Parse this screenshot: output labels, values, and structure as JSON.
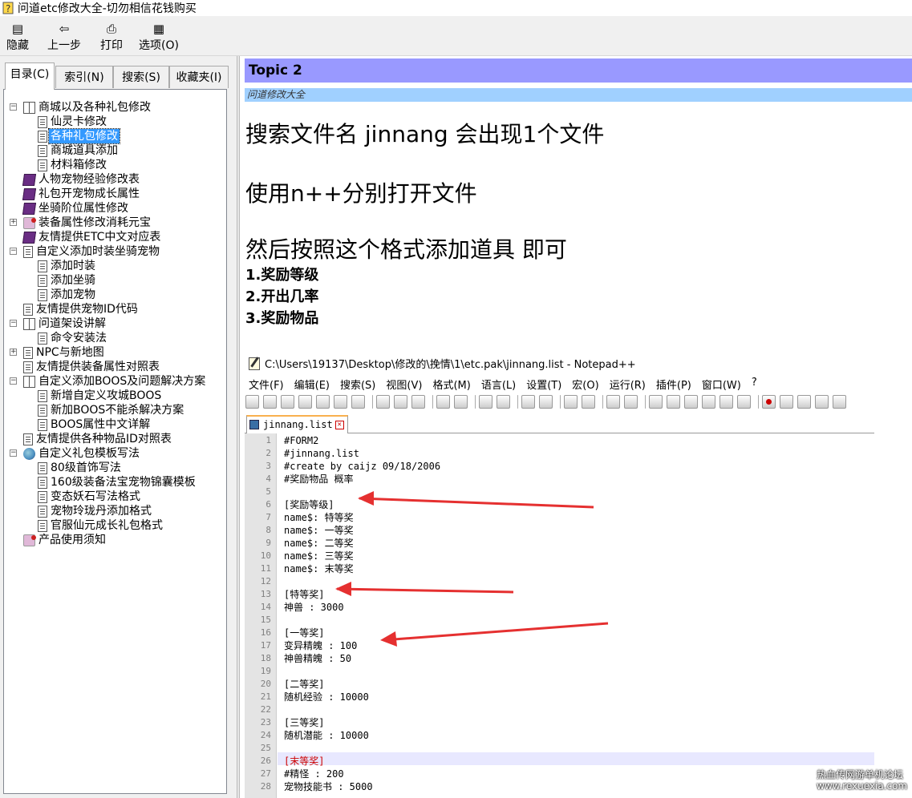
{
  "window": {
    "title": "问道etc修改大全-切勿相信花钱购买"
  },
  "toolbar": {
    "hide": "隐藏",
    "back": "上一步",
    "print": "打印",
    "options": "选项(O)"
  },
  "tabs": [
    "目录(C)",
    "索引(N)",
    "搜索(S)",
    "收藏夹(I)"
  ],
  "tree": [
    {
      "label": "商城以及各种礼包修改",
      "icon": "book-open-icon",
      "toggle": "⊟"
    },
    {
      "label": "仙灵卡修改",
      "icon": "page-icon"
    },
    {
      "label": "各种礼包修改",
      "icon": "page-icon",
      "selected": true
    },
    {
      "label": "商城道具添加",
      "icon": "page-icon"
    },
    {
      "label": "材料箱修改",
      "icon": "page-icon"
    },
    {
      "label": "人物宠物经验修改表",
      "icon": "book-icon"
    },
    {
      "label": "礼包开宠物成长属性",
      "icon": "book-icon"
    },
    {
      "label": "坐骑阶位属性修改",
      "icon": "book-icon"
    },
    {
      "label": "装备属性修改消耗元宝",
      "icon": "special-page-icon",
      "toggle": "⊞"
    },
    {
      "label": "友情提供ETC中文对应表",
      "icon": "book-icon"
    },
    {
      "label": "自定义添加时装坐骑宠物",
      "icon": "page-icon",
      "toggle": "⊟"
    },
    {
      "label": "添加时装",
      "icon": "page-icon"
    },
    {
      "label": "添加坐骑",
      "icon": "page-icon"
    },
    {
      "label": "添加宠物",
      "icon": "page-icon"
    },
    {
      "label": "友情提供宠物ID代码",
      "icon": "page-icon"
    },
    {
      "label": "问道架设讲解",
      "icon": "book-open-icon",
      "toggle": "⊟"
    },
    {
      "label": "命令安装法",
      "icon": "page-icon"
    },
    {
      "label": "NPC与新地图",
      "icon": "page-icon",
      "toggle": "⊞"
    },
    {
      "label": "友情提供装备属性对照表",
      "icon": "page-icon"
    },
    {
      "label": "自定义添加BOOS及问题解决方案",
      "icon": "book-open-icon",
      "toggle": "⊟"
    },
    {
      "label": "新增自定义攻城BOOS",
      "icon": "page-icon"
    },
    {
      "label": "新加BOOS不能杀解决方案",
      "icon": "page-icon"
    },
    {
      "label": "BOOS属性中文详解",
      "icon": "page-icon"
    },
    {
      "label": "友情提供各种物品ID对照表",
      "icon": "page-icon"
    },
    {
      "label": "自定义礼包模板写法",
      "icon": "globe-icon",
      "toggle": "⊟"
    },
    {
      "label": "80级首饰写法",
      "icon": "page-icon"
    },
    {
      "label": "160级装备法宝宠物锦囊模板",
      "icon": "page-icon"
    },
    {
      "label": "变态妖石写法格式",
      "icon": "page-icon"
    },
    {
      "label": "宠物玲珑丹添加格式",
      "icon": "page-icon"
    },
    {
      "label": "官服仙元成长礼包格式",
      "icon": "page-icon"
    },
    {
      "label": "产品使用须知",
      "icon": "special-page-icon"
    }
  ],
  "content": {
    "topic": "Topic 2",
    "subtitle": "问道修改大全",
    "line1": "搜索文件名 jinnang 会出现1个文件",
    "line2": "使用n++分别打开文件",
    "line3": "然后按照这个格式添加道具 即可",
    "item1": "1.奖励等级",
    "item2": "2.开出几率",
    "item3": "3.奖励物品"
  },
  "notepad": {
    "title": "C:\\Users\\19137\\Desktop\\修改的\\挽情\\1\\etc.pak\\jinnang.list - Notepad++",
    "menu": [
      "文件(F)",
      "编辑(E)",
      "搜索(S)",
      "视图(V)",
      "格式(M)",
      "语言(L)",
      "设置(T)",
      "宏(O)",
      "运行(R)",
      "插件(P)",
      "窗口(W)",
      "?"
    ],
    "tab": "jinnang.list",
    "lines": [
      "#FORM2",
      "#jinnang.list",
      "#create by caijz 09/18/2006",
      "#奖励物品        概率",
      "",
      "[奖励等级]",
      "name$: 特等奖",
      "name$: 一等奖",
      "name$: 二等奖",
      "name$: 三等奖",
      "name$: 末等奖",
      "",
      "[特等奖]",
      "神兽 : 3000",
      "",
      "[一等奖]",
      "变异精魄 : 100",
      "神兽精魄 : 50",
      "",
      "[二等奖]",
      "随机经验 : 10000",
      "",
      "[三等奖]",
      "随机潜能 : 10000",
      "",
      "[末等奖]",
      "#精怪 : 200",
      "宠物技能书 : 5000"
    ],
    "line_numbers": [
      "1",
      "2",
      "3",
      "4",
      "5",
      "6",
      "7",
      "8",
      "9",
      "10",
      "11",
      "12",
      "13",
      "14",
      "15",
      "16",
      "17",
      "18",
      "19",
      "20",
      "21",
      "22",
      "23",
      "24",
      "25",
      "26",
      "27",
      "28"
    ]
  },
  "watermark": {
    "line1": "热血传网游单机论坛",
    "line2": "www.rexuexia.com"
  },
  "colors": {
    "topic_bg": "#9999ff",
    "subbar_bg": "#a0d0ff",
    "selection": "#3399ff",
    "arrow": "#e53030"
  }
}
